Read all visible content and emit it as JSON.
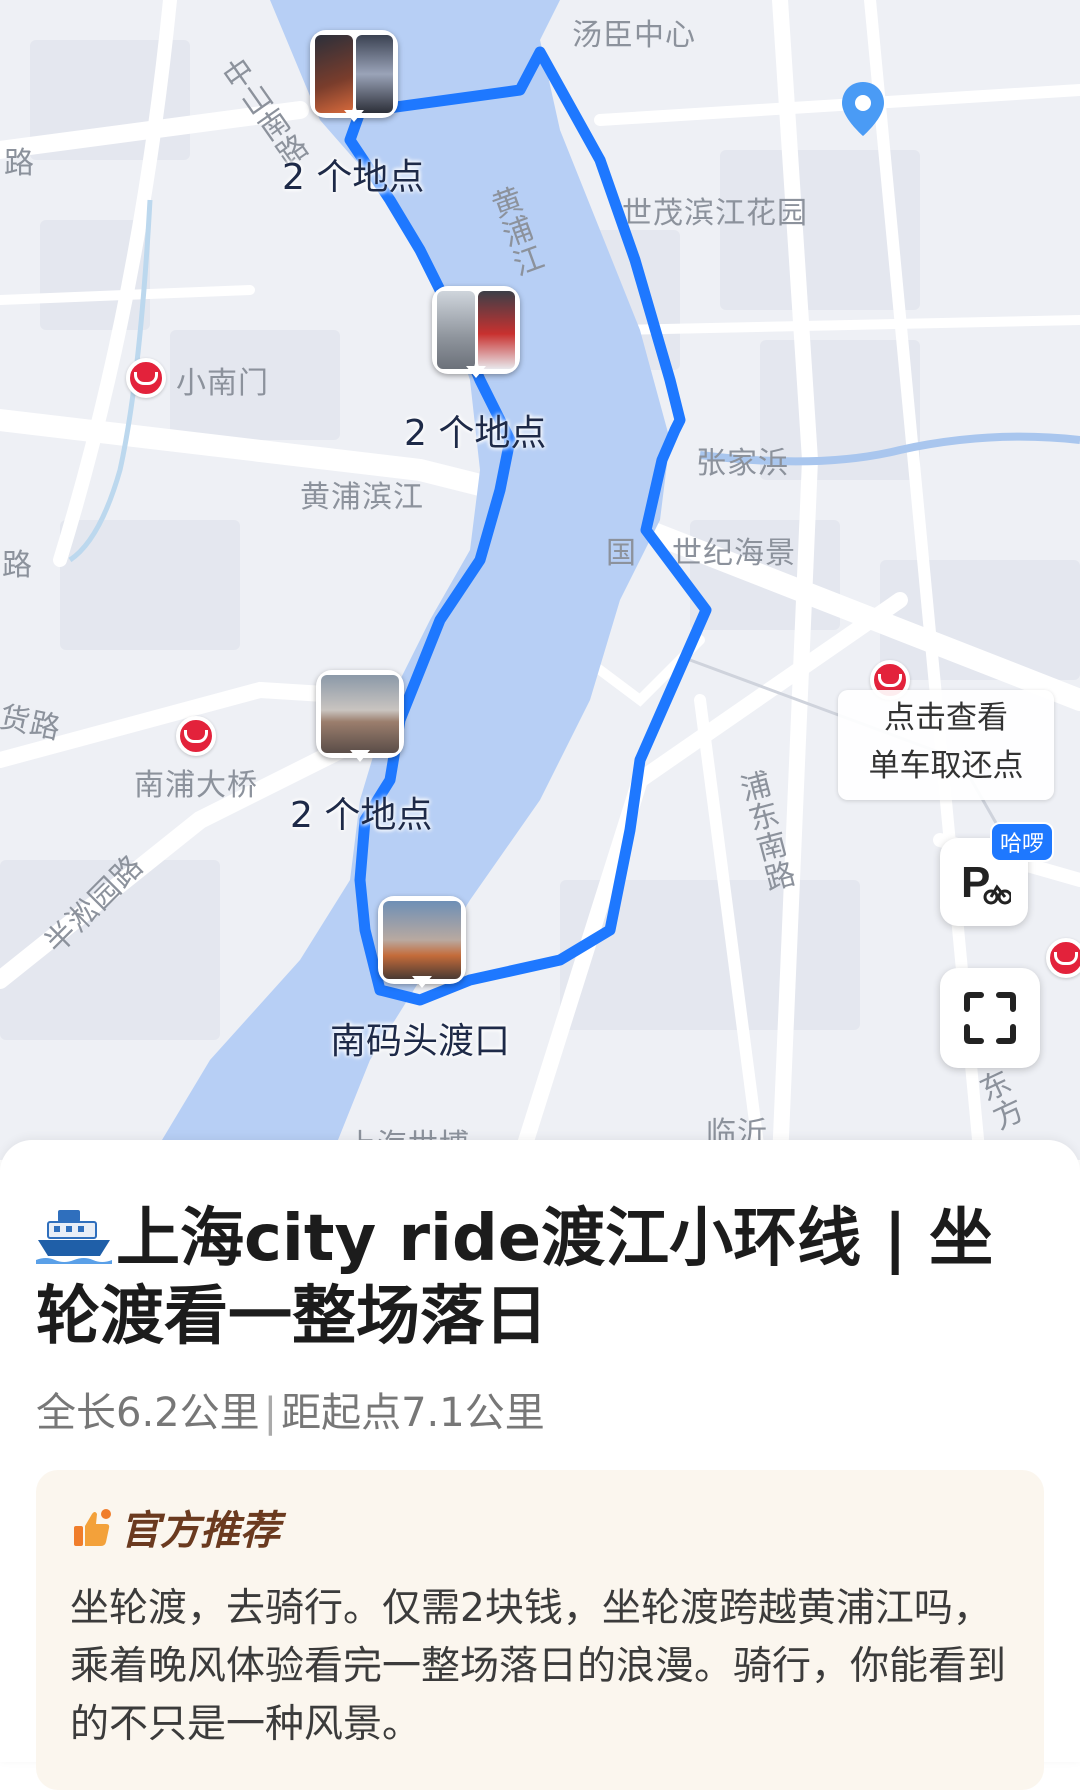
{
  "map": {
    "labels": {
      "tangchen": "汤臣中心",
      "zhongshan_road": "中山南路",
      "road_left_top": "路",
      "huangpu_river": "黄浦江",
      "shimao": "世茂滨江花园",
      "xiaonanmen": "小南门",
      "zhangjiabang": "张家浜",
      "huangpu_binjiang": "黄浦滨江",
      "shiji_haijing": "世纪海景",
      "guo": "国",
      "road_left_mid": "路",
      "huolu": "货路",
      "nanpu_bridge": "南浦大桥",
      "pudong_nanlu": "浦东南路",
      "bansong_yuan": "半淞园路",
      "lingyi": "临沂",
      "shanghai_shibo": "上海世博",
      "dongfang": "东方"
    },
    "markers": [
      {
        "caption": "2 个地点"
      },
      {
        "caption": "2 个地点"
      },
      {
        "caption": "2 个地点"
      },
      {
        "caption": "南码头渡口"
      }
    ],
    "bike_bubble": {
      "line1": "点击查看",
      "line2": "单车取还点"
    },
    "hello_badge": "哈啰",
    "route_color": "#1e78ff",
    "river_color": "#b7cff5"
  },
  "sheet": {
    "title": "上海city ride渡江小环线 | 坐轮渡看一整场落日",
    "length": "全长6.2公里",
    "separator": "|",
    "distance": "距起点7.1公里",
    "recommend": {
      "heading": "官方推荐",
      "text": "坐轮渡，去骑行。仅需2块钱，坐轮渡跨越黄浦江吗，乘着晚风体验看完一整场落日的浪漫。骑行，你能看到的不只是一种风景。"
    }
  }
}
